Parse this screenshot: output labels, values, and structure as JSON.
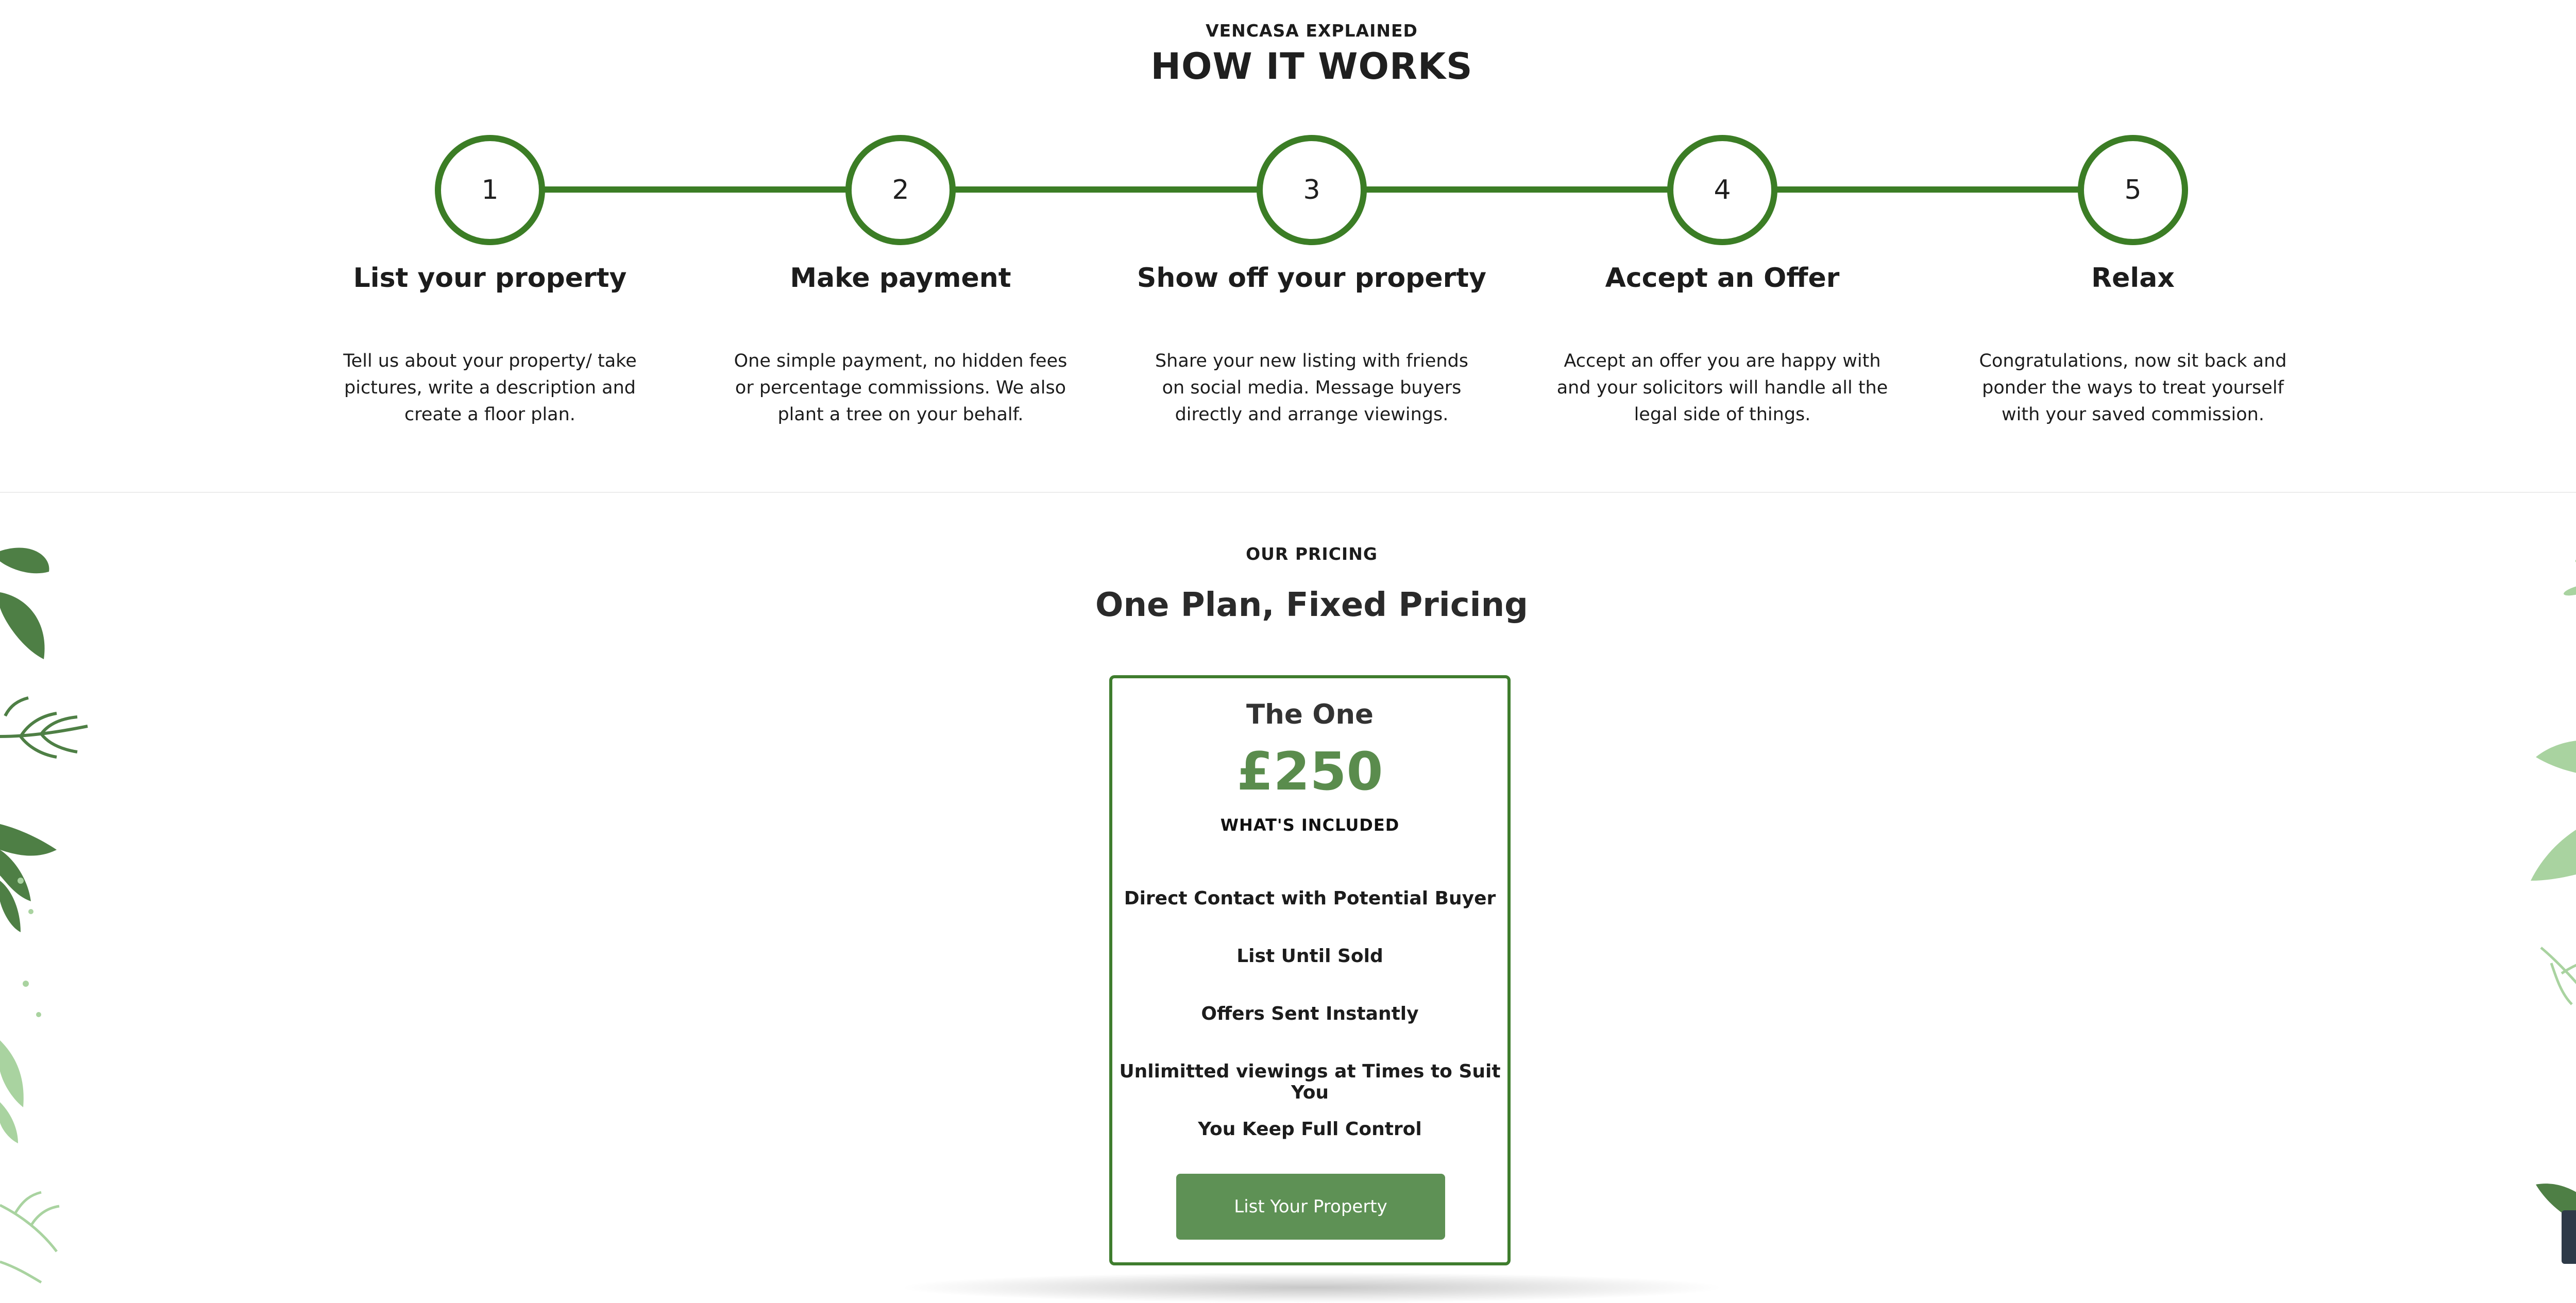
{
  "how_it_works": {
    "kicker": "VENCASA EXPLAINED",
    "title": "HOW IT WORKS",
    "steps": [
      {
        "number": "1",
        "title": "List your property",
        "description": "Tell us about your property/ take pictures, write a description and create a floor plan."
      },
      {
        "number": "2",
        "title": "Make payment",
        "description": "One simple payment, no hidden fees or percentage commissions. We also plant a tree on your behalf."
      },
      {
        "number": "3",
        "title": "Show off your property",
        "description": "Share your new listing with friends on social media. Message buyers directly and arrange viewings."
      },
      {
        "number": "4",
        "title": "Accept an Offer",
        "description": "Accept an offer you are happy with and your solicitors will handle all the legal side of things."
      },
      {
        "number": "5",
        "title": "Relax",
        "description": "Congratulations, now sit back and ponder the ways to treat yourself with your saved commission."
      }
    ]
  },
  "pricing": {
    "kicker": "OUR PRICING",
    "title": "One Plan, Fixed Pricing",
    "plan": {
      "name": "The One",
      "price": "£250",
      "included_label": "WHAT'S INCLUDED",
      "features": [
        "Direct Contact with Potential Buyer",
        "List Until Sold",
        "Offers Sent Instantly",
        "Unlimitted viewings at Times to Suit You",
        "You Keep Full Control"
      ],
      "cta_label": "List Your Property"
    }
  },
  "colors": {
    "accent_green": "#3b7d25",
    "button_green": "#5e9155",
    "price_green": "#5a8c4d",
    "leaf_dark": "#4e7f45",
    "leaf_light": "#a9d3a0",
    "back_to_top_bg": "#2e3a48"
  },
  "icons": {
    "back_to_top": "double-chevron-up-icon",
    "decor_left": "leaf-decoration-icon",
    "decor_right": "leaf-decoration-icon"
  }
}
